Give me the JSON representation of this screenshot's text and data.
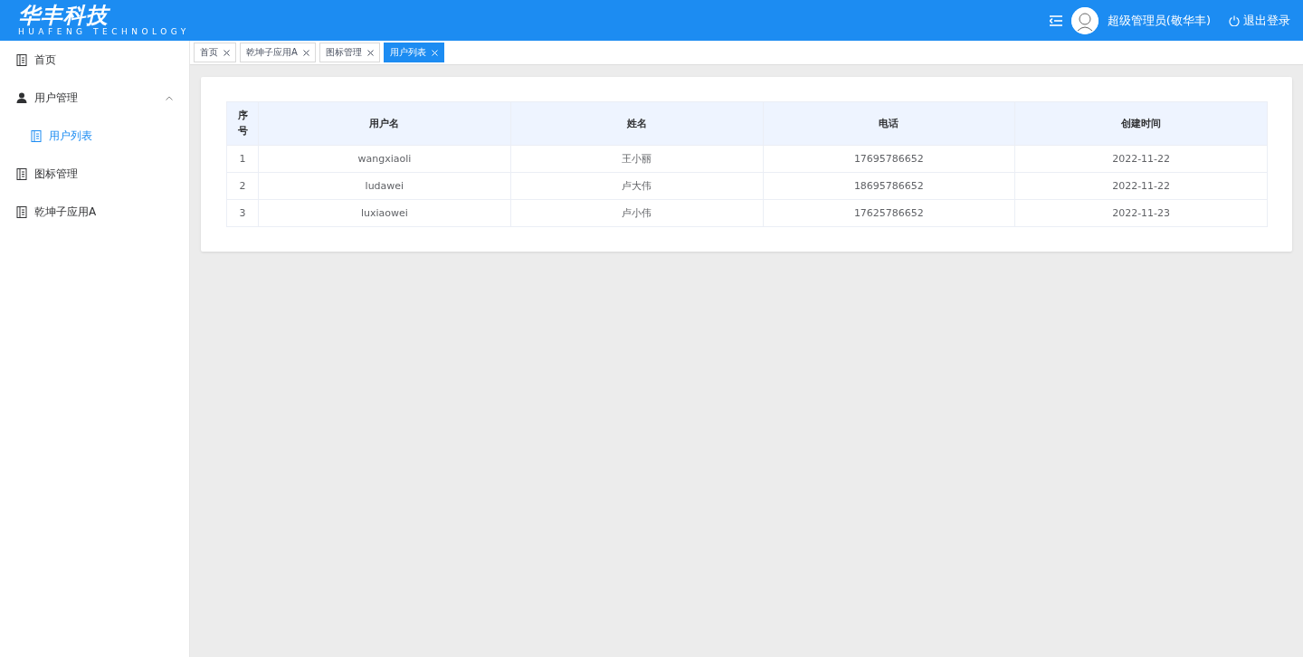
{
  "header": {
    "logo": "华丰科技",
    "logo_subtitle": "HUAFENG TECHNOLOGY",
    "user_name": "超级管理员(敬华丰)",
    "logout": "退出登录"
  },
  "sidebar": {
    "items": [
      {
        "label": "首页",
        "kind": "page",
        "selected": false
      },
      {
        "label": "用户管理",
        "kind": "group",
        "selected": false,
        "expanded": true,
        "children": [
          {
            "label": "用户列表",
            "kind": "page",
            "selected": true
          }
        ]
      },
      {
        "label": "图标管理",
        "kind": "page",
        "selected": false
      },
      {
        "label": "乾坤子应用A",
        "kind": "page",
        "selected": false
      }
    ]
  },
  "tabs": [
    {
      "label": "首页",
      "selected": false
    },
    {
      "label": "乾坤子应用A",
      "selected": false
    },
    {
      "label": "图标管理",
      "selected": false
    },
    {
      "label": "用户列表",
      "selected": true
    }
  ],
  "table": {
    "columns": [
      "序号",
      "用户名",
      "姓名",
      "电话",
      "创建时间"
    ],
    "rows": [
      [
        "1",
        "wangxiaoli",
        "王小丽",
        "17695786652",
        "2022-11-22"
      ],
      [
        "2",
        "ludawei",
        "卢大伟",
        "18695786652",
        "2022-11-22"
      ],
      [
        "3",
        "luxiaowei",
        "卢小伟",
        "17625786652",
        "2022-11-23"
      ]
    ]
  }
}
